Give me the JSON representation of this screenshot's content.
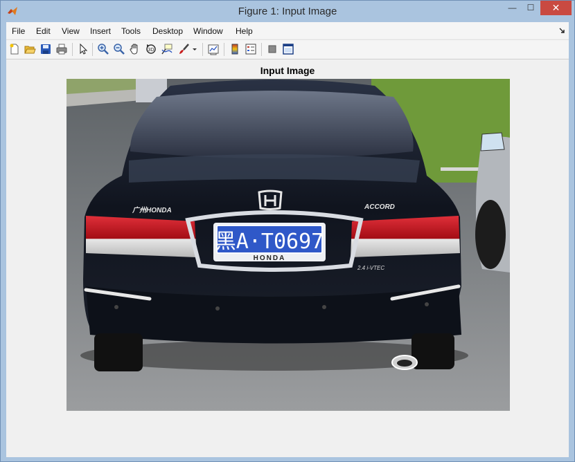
{
  "window": {
    "title": "Figure 1: Input Image",
    "controls": {
      "minimize": "—",
      "maximize": "☐",
      "close": "✕"
    }
  },
  "menu": [
    "File",
    "Edit",
    "View",
    "Insert",
    "Tools",
    "Desktop",
    "Window",
    "Help"
  ],
  "toolbar": {
    "icons": [
      "new-figure-icon",
      "open-file-icon",
      "save-icon",
      "print-icon",
      "edit-plot-arrow-icon",
      "zoom-in-icon",
      "zoom-out-icon",
      "pan-hand-icon",
      "rotate-3d-icon",
      "data-cursor-icon",
      "brush-icon",
      "brush-dropdown-icon",
      "link-plot-icon",
      "colorbar-icon",
      "legend-icon",
      "hide-plot-tools-icon",
      "show-plot-tools-icon"
    ]
  },
  "axes": {
    "title": "Input Image"
  },
  "photo": {
    "plate_text": "黑A·T0697",
    "plate_brand": "HONDA",
    "badge_left": "广州HONDA",
    "badge_right": "ACCORD",
    "badge_engine": "2.4 i-VTEC",
    "colors": {
      "car": "#141a26",
      "plate": "#2f58c8",
      "lights": "#c0141c",
      "grass": "#6f9a3a",
      "road": "#8a8c8e"
    }
  }
}
